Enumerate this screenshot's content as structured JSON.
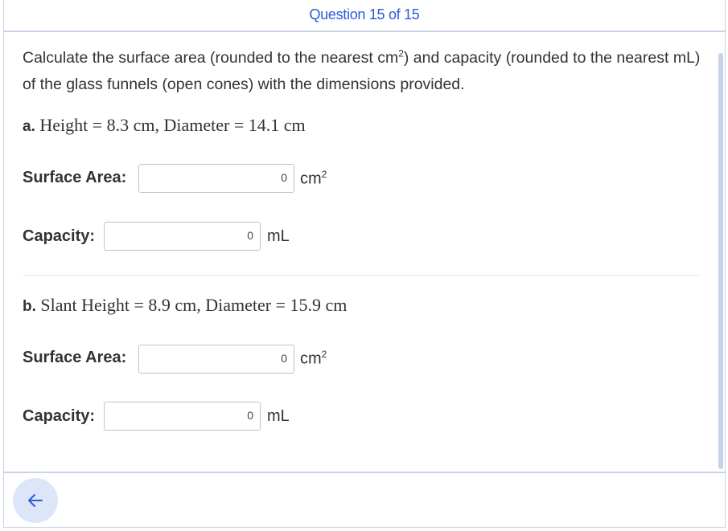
{
  "header": {
    "title": "Question 15 of 15"
  },
  "question": {
    "prompt_before_sup": "Calculate the surface area (rounded to the nearest cm",
    "prompt_sup": "2",
    "prompt_after_sup": ") and capacity (rounded to the nearest mL) of the glass funnels (open cones) with the dimensions provided."
  },
  "parts": [
    {
      "letter": "a.",
      "expression": "Height = 8.3 cm, Diameter = 14.1 cm",
      "surface_area": {
        "label": "Surface Area:",
        "value": "0",
        "unit": "cm",
        "unit_sup": "2"
      },
      "capacity": {
        "label": "Capacity:",
        "value": "0",
        "unit": "mL"
      }
    },
    {
      "letter": "b.",
      "expression": "Slant Height = 8.9 cm, Diameter = 15.9 cm",
      "surface_area": {
        "label": "Surface Area:",
        "value": "0",
        "unit": "cm",
        "unit_sup": "2"
      },
      "capacity": {
        "label": "Capacity:",
        "value": "0",
        "unit": "mL"
      }
    }
  ],
  "footer": {
    "back_icon": "arrow-left-icon"
  },
  "colors": {
    "accent": "#2a5bd7",
    "border": "#c9d3e6",
    "back_bg": "#dde6f8"
  }
}
